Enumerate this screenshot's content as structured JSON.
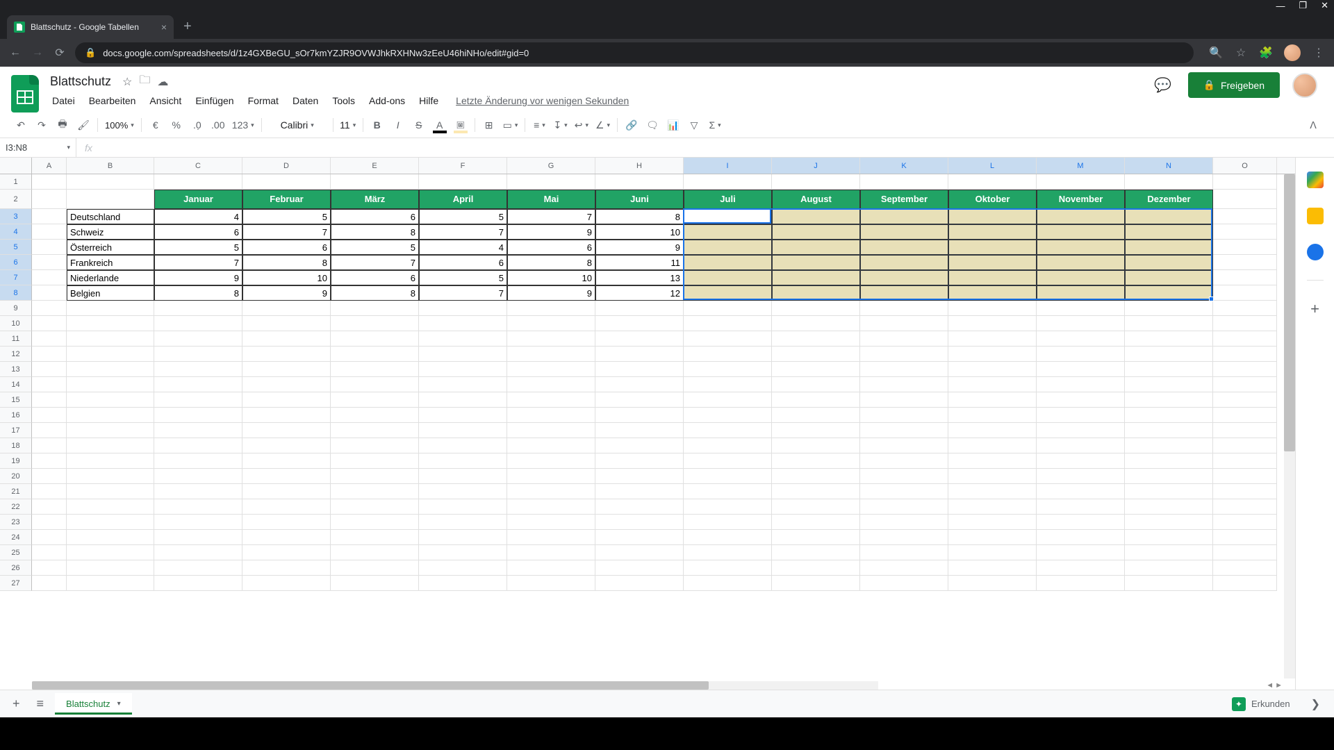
{
  "browser": {
    "tab_title": "Blattschutz - Google Tabellen",
    "url": "docs.google.com/spreadsheets/d/1z4GXBeGU_sOr7kmYZJR9OVWJhkRXHNw3zEeU46hiNHo/edit#gid=0"
  },
  "doc": {
    "title": "Blattschutz",
    "last_edit": "Letzte Änderung vor wenigen Sekunden",
    "share_label": "Freigeben"
  },
  "menus": [
    "Datei",
    "Bearbeiten",
    "Ansicht",
    "Einfügen",
    "Format",
    "Daten",
    "Tools",
    "Add-ons",
    "Hilfe"
  ],
  "toolbar": {
    "zoom": "100%",
    "format_number": "123",
    "font": "Calibri",
    "font_size": "11"
  },
  "name_box": "I3:N8",
  "formula_value": "",
  "columns": [
    "A",
    "B",
    "C",
    "D",
    "E",
    "F",
    "G",
    "H",
    "I",
    "J",
    "K",
    "L",
    "M",
    "N",
    "O"
  ],
  "header_row": [
    "Januar",
    "Februar",
    "März",
    "April",
    "Mai",
    "Juni",
    "Juli",
    "August",
    "September",
    "Oktober",
    "November",
    "Dezember"
  ],
  "data_rows": [
    {
      "label": "Deutschland",
      "values": [
        "4",
        "5",
        "6",
        "5",
        "7",
        "8"
      ]
    },
    {
      "label": "Schweiz",
      "values": [
        "6",
        "7",
        "8",
        "7",
        "9",
        "10"
      ]
    },
    {
      "label": "Österreich",
      "values": [
        "5",
        "6",
        "5",
        "4",
        "6",
        "9"
      ]
    },
    {
      "label": "Frankreich",
      "values": [
        "7",
        "8",
        "7",
        "6",
        "8",
        "11"
      ]
    },
    {
      "label": "Niederlande",
      "values": [
        "9",
        "10",
        "6",
        "5",
        "10",
        "13"
      ]
    },
    {
      "label": "Belgien",
      "values": [
        "8",
        "9",
        "8",
        "7",
        "9",
        "12"
      ]
    }
  ],
  "sheet_tab": "Blattschutz",
  "explore_label": "Erkunden"
}
